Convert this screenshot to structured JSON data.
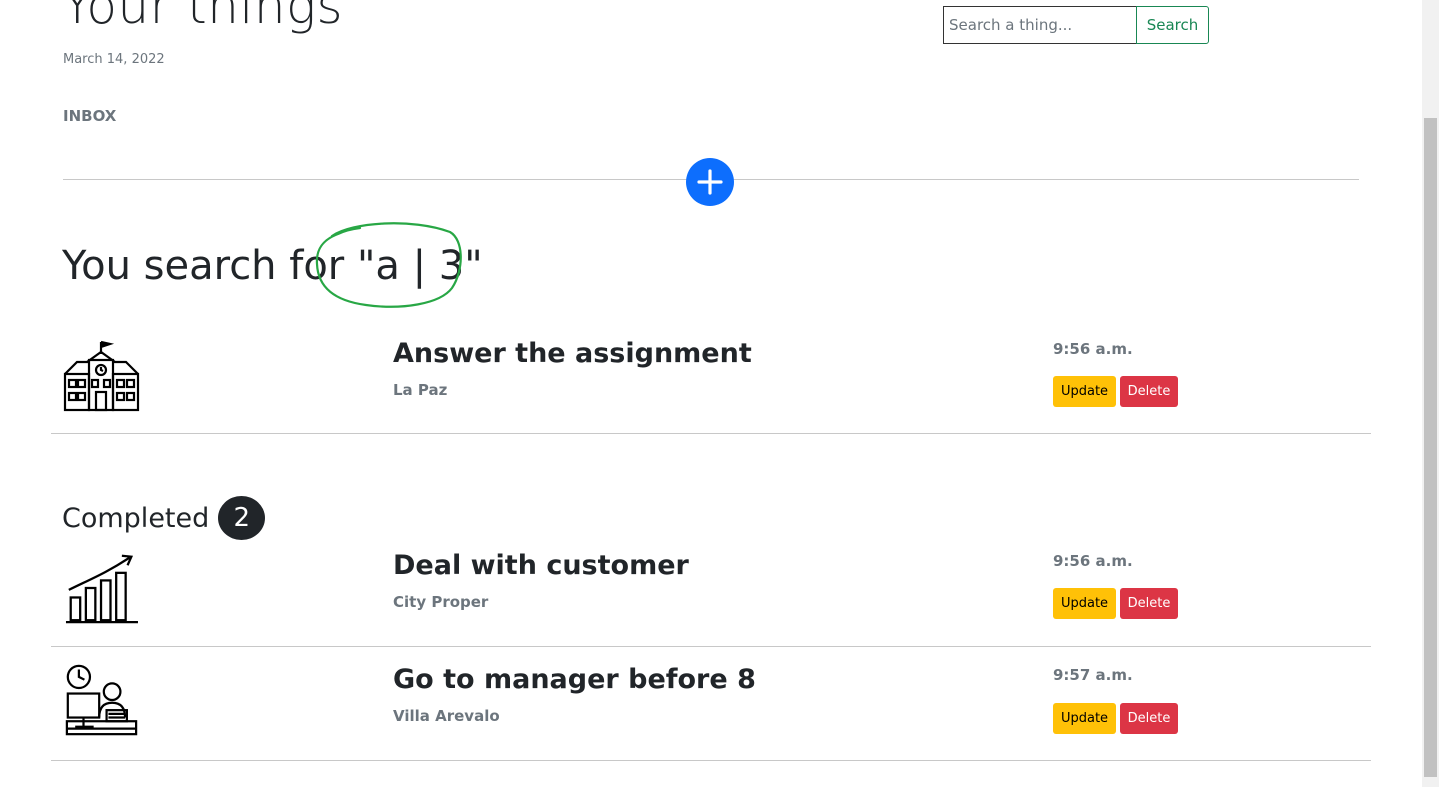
{
  "header": {
    "title": "Your things",
    "date": "March 14, 2022",
    "section": "INBOX"
  },
  "search": {
    "placeholder": "Search a thing...",
    "button_label": "Search"
  },
  "add_button": {
    "icon": "plus-icon",
    "color": "#0d6efd"
  },
  "search_result": {
    "prefix": "You search for",
    "query": "\"a | 3\"",
    "annotation_color": "#28a745"
  },
  "inbox_items": [
    {
      "title": "Answer the assignment",
      "location": "La Paz",
      "time": "9:56 a.m.",
      "icon": "school-icon",
      "update_label": "Update",
      "delete_label": "Delete"
    }
  ],
  "completed": {
    "label": "Completed",
    "count": "2",
    "items": [
      {
        "title": "Deal with customer",
        "location": "City Proper",
        "time": "9:56 a.m.",
        "icon": "growth-chart-icon",
        "update_label": "Update",
        "delete_label": "Delete"
      },
      {
        "title": "Go to manager before 8",
        "location": "Villa Arevalo",
        "time": "9:57 a.m.",
        "icon": "office-worker-icon",
        "update_label": "Update",
        "delete_label": "Delete"
      }
    ]
  },
  "colors": {
    "update": "#ffc107",
    "delete": "#dc3545",
    "search": "#198754",
    "muted": "#6c757d"
  }
}
